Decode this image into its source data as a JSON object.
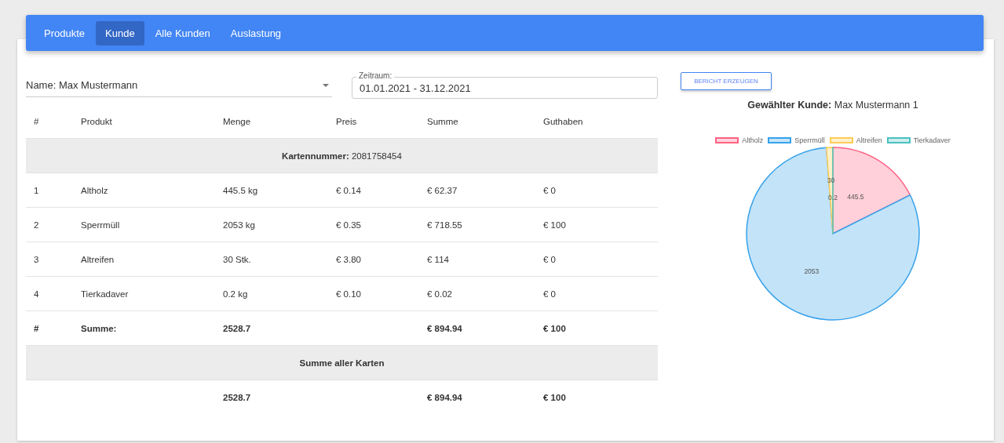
{
  "nav": {
    "tabs": [
      {
        "label": "Produkte",
        "selected": false
      },
      {
        "label": "Kunde",
        "selected": true
      },
      {
        "label": "Alle Kunden",
        "selected": false
      },
      {
        "label": "Auslastung",
        "selected": false
      }
    ]
  },
  "filters": {
    "customer_select": {
      "value": "Name: Max Mustermann"
    },
    "period": {
      "label": "Zeitraum:",
      "value": "01.01.2021 - 31.12.2021"
    }
  },
  "table": {
    "columns": [
      "#",
      "Produkt",
      "Menge",
      "Preis",
      "Summe",
      "Guthaben"
    ],
    "card_header": "**Kartennummer:** 2081758454",
    "rows": [
      [
        "1",
        "Altholz",
        "445.5 kg",
        "€ 0.14",
        "€ 62.37",
        "€ 0"
      ],
      [
        "2",
        "Sperrmüll",
        "2053 kg",
        "€ 0.35",
        "€ 718.55",
        "€ 100"
      ],
      [
        "3",
        "Altreifen",
        "30 Stk.",
        "€ 3.80",
        "€ 114",
        "€ 0"
      ],
      [
        "4",
        "Tierkadaver",
        "0.2 kg",
        "€ 0.10",
        "€ 0.02",
        "€ 0"
      ]
    ],
    "sum_row": {
      "index": "#",
      "label": "Summe:",
      "menge": "2528.7",
      "summe": "€ 894.94",
      "guthaben": "€ 100"
    },
    "total_header": "Summe aller Karten",
    "total_row": {
      "menge": "2528.7",
      "summe": "€ 894.94",
      "guthaben": "€ 100"
    }
  },
  "report": {
    "button": "BERICHT ERZEUGEN",
    "title": "**Gewählter Kunde:** Max Mustermann 1",
    "legend": [
      {
        "color": "#ff6384"
      },
      {
        "color": "#36a2eb"
      },
      {
        "color": "#ffcd56"
      },
      {
        "color": "#4bc0c0"
      }
    ],
    "chart_data": {
      "type": "pie",
      "categories": [
        "Altholz",
        "Sperrmüll",
        "Altreifen",
        "Tierkadaver"
      ],
      "values": [
        445.5,
        2053,
        30,
        0.2
      ],
      "data_labels": true
    }
  }
}
